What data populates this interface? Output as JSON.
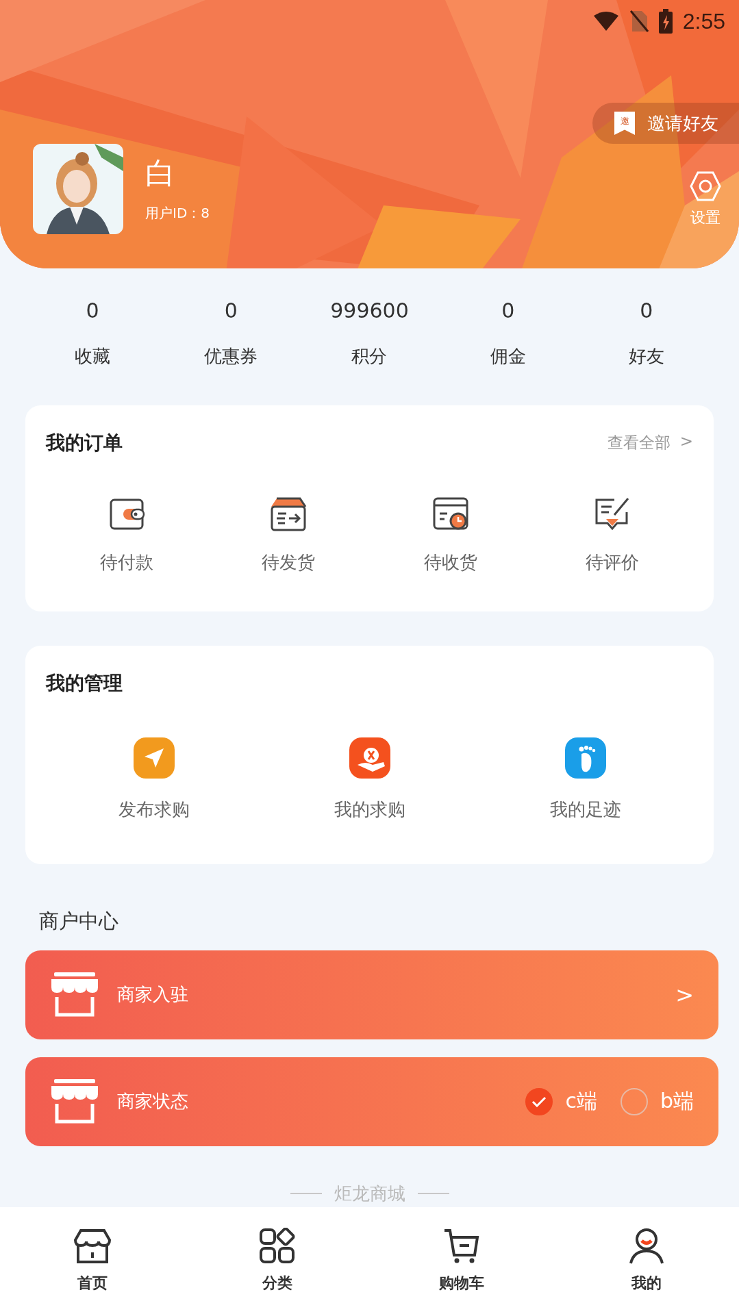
{
  "status_bar": {
    "time": "2:55"
  },
  "profile": {
    "invite_glyph": "邀",
    "invite_button": "邀请好友",
    "name": "白",
    "user_id": "用户ID：8",
    "settings": "设置"
  },
  "stats": [
    {
      "value": "0",
      "label": "收藏"
    },
    {
      "value": "0",
      "label": "优惠券"
    },
    {
      "value": "999600",
      "label": "积分"
    },
    {
      "value": "0",
      "label": "佣金"
    },
    {
      "value": "0",
      "label": "好友"
    }
  ],
  "orders": {
    "title": "我的订单",
    "view_all": "查看全部",
    "chevron": ">",
    "items": [
      {
        "kind": "wallet",
        "label": "待付款"
      },
      {
        "kind": "box",
        "label": "待发货"
      },
      {
        "kind": "calendar",
        "label": "待收货"
      },
      {
        "kind": "review",
        "label": "待评价"
      }
    ]
  },
  "management": {
    "title": "我的管理",
    "items": [
      {
        "kind": "send",
        "color": "#f29a1e",
        "label": "发布求购"
      },
      {
        "kind": "hand",
        "color": "#f4511e",
        "label": "我的求购"
      },
      {
        "kind": "foot",
        "color": "#1a9ee8",
        "label": "我的足迹"
      }
    ]
  },
  "merchant": {
    "title": "商户中心",
    "banners": [
      {
        "kind": "link",
        "label": "商家入驻",
        "chevron": ">"
      },
      {
        "kind": "status",
        "label": "商家状态",
        "options": [
          {
            "label": "c端",
            "selected": true
          },
          {
            "label": "b端",
            "selected": false
          }
        ]
      }
    ]
  },
  "footer": "炬龙商城",
  "tabbar": [
    {
      "kind": "home",
      "label": "首页",
      "selected": false
    },
    {
      "kind": "category",
      "label": "分类",
      "selected": false
    },
    {
      "kind": "cart",
      "label": "购物车",
      "selected": false
    },
    {
      "kind": "me",
      "label": "我的",
      "selected": true
    }
  ]
}
